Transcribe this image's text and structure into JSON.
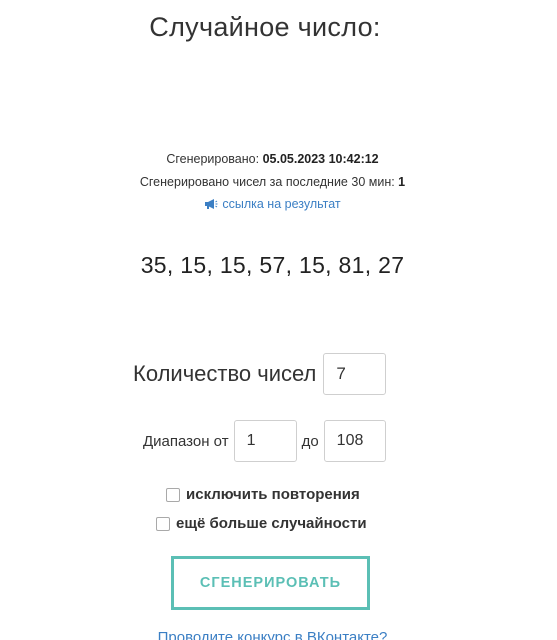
{
  "title": "Случайное число:",
  "generated": {
    "label": "Сгенерировано: ",
    "value": "05.05.2023 10:42:12"
  },
  "count_last_30": {
    "label": "Сгенерировано чисел за последние 30 мин: ",
    "value": "1"
  },
  "result_link": {
    "icon": "megaphone-icon",
    "label": "ссылка на результат"
  },
  "result_numbers": "35, 15, 15, 57, 15, 81, 27",
  "form": {
    "count_label": "Количество чисел",
    "count_value": "7",
    "range_label": "Диапазон от",
    "range_from": "1",
    "range_to_label": "до",
    "range_to": "108",
    "exclude_repeats_label": "исключить повторения",
    "exclude_repeats_checked": false,
    "more_random_label": "ещё больше случайности",
    "more_random_checked": false
  },
  "generate_button": "СГЕНЕРИРОВАТЬ",
  "bottom_link": "Проводите конкурс в ВКонтакте?",
  "colors": {
    "accent": "#5bbfb5",
    "link": "#3b7fc4",
    "text": "#333333"
  }
}
